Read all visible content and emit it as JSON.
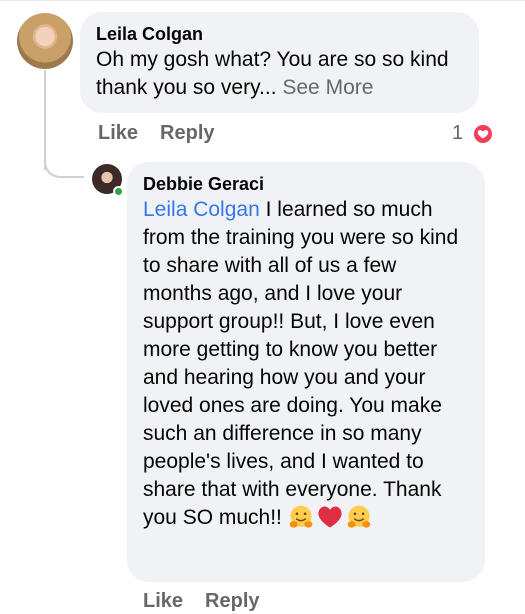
{
  "comment1": {
    "author": "Leila Colgan",
    "text": "Oh my gosh what?  You are so so kind thank you so very...",
    "see_more": "See More",
    "like_label": "Like",
    "reply_label": "Reply",
    "reaction_count": "1",
    "reaction_icon": "love-reaction-icon",
    "reaction_color": "#f33e58"
  },
  "comment2": {
    "author": "Debbie Geraci",
    "mention": "Leila Colgan",
    "text": "I learned so much from the training you were so kind to share with all of us a few months ago, and I love your support group!! But,  I love even more getting to know you better and hearing how you and your loved ones are doing. You make such an difference in so many people's lives, and I wanted to share that with everyone. Thank you SO much!!",
    "emojis": [
      "hugging-face-emoji",
      "red-heart-emoji",
      "hugging-face-emoji"
    ],
    "like_label": "Like",
    "reply_label": "Reply",
    "online_color": "#31a24c"
  },
  "colors": {
    "bubble": "#f0f2f5",
    "mention": "#3578e5",
    "secondary_text": "#65676b"
  }
}
